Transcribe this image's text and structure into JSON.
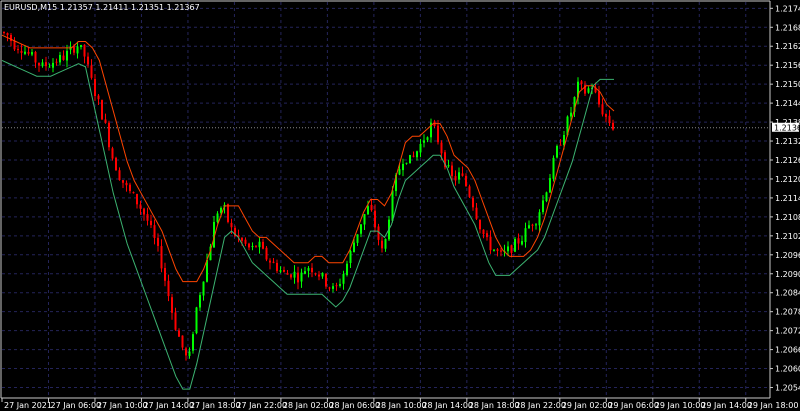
{
  "header": {
    "symbol_info": "EURUSD,M15  1.21357 1.21411 1.21351 1.21367"
  },
  "colors": {
    "background": "#000000",
    "grid": "#24245a",
    "axis": "#c8c8c8",
    "bull_candle": "#00ff00",
    "bear_candle": "#ff0000",
    "upper_band": "#ff4500",
    "lower_band": "#3cb371",
    "price_label_bg": "#ffffff",
    "price_label_text": "#000000"
  },
  "chart_data": {
    "type": "line",
    "title": "EURUSD,M15",
    "ohlc_header": "1.21357 1.21411 1.21351 1.21367",
    "current_price": 1.21367,
    "current_price_label": "1.21367",
    "grid": true,
    "y_axis_side": "right",
    "ylim": [
      1.20515,
      1.21765
    ],
    "yticks": [
      "1.21745",
      "1.21685",
      "1.21625",
      "1.21565",
      "1.21505",
      "1.21445",
      "1.21385",
      "1.21325",
      "1.21265",
      "1.21205",
      "1.21145",
      "1.21085",
      "1.21025",
      "1.20965",
      "1.20905",
      "1.20845",
      "1.20785",
      "1.20725",
      "1.20665",
      "1.20605",
      "1.20545"
    ],
    "xticks": [
      "27 Jan 2021",
      "27 Jan 06:00",
      "27 Jan 10:00",
      "27 Jan 14:00",
      "27 Jan 18:00",
      "27 Jan 22:00",
      "28 Jan 02:00",
      "28 Jan 06:00",
      "28 Jan 10:00",
      "28 Jan 14:00",
      "28 Jan 18:00",
      "28 Jan 22:00",
      "29 Jan 02:00",
      "29 Jan 06:00",
      "29 Jan 10:00",
      "29 Jan 14:00",
      "29 Jan 18:00"
    ],
    "price_path": [
      1.2167,
      1.2166,
      1.2163,
      1.2162,
      1.216,
      1.2158,
      1.2156,
      1.2157,
      1.2158,
      1.2159,
      1.2161,
      1.2163,
      1.216,
      1.2152,
      1.2145,
      1.2138,
      1.2128,
      1.2122,
      1.2118,
      1.2115,
      1.2112,
      1.2108,
      1.2102,
      1.2095,
      1.2085,
      1.2075,
      1.2068,
      1.2062,
      1.2078,
      1.2088,
      1.2098,
      1.211,
      1.2112,
      1.2105,
      1.2102,
      1.21,
      1.2098,
      1.21,
      1.2096,
      1.2094,
      1.2092,
      1.209,
      1.2091,
      1.2089,
      1.2093,
      1.2092,
      1.209,
      1.2087,
      1.2085,
      1.2089,
      1.2095,
      1.2102,
      1.2108,
      1.2112,
      1.2104,
      1.2096,
      1.2112,
      1.2122,
      1.2128,
      1.2126,
      1.213,
      1.2134,
      1.2138,
      1.2132,
      1.2125,
      1.212,
      1.2122,
      1.2118,
      1.2112,
      1.2105,
      1.21,
      1.2098,
      1.2096,
      1.2098,
      1.21,
      1.2102,
      1.2106,
      1.2108,
      1.2114,
      1.2122,
      1.213,
      1.2136,
      1.2142,
      1.215,
      1.2148,
      1.215,
      1.2144,
      1.214,
      1.2137
    ],
    "series": [
      {
        "name": "",
        "color": "#ff4500",
        "values": [
          1.2166,
          1.2165,
          1.2164,
          1.2163,
          1.2162,
          1.2162,
          1.2162,
          1.2162,
          1.2162,
          1.2162,
          1.2162,
          1.2164,
          1.2164,
          1.2162,
          1.2158,
          1.215,
          1.2142,
          1.2134,
          1.2126,
          1.212,
          1.2116,
          1.2112,
          1.2108,
          1.2104,
          1.2098,
          1.2092,
          1.2088,
          1.2088,
          1.2088,
          1.2092,
          1.2098,
          1.2106,
          1.2112,
          1.2112,
          1.2112,
          1.2108,
          1.2104,
          1.2102,
          1.2102,
          1.21,
          1.2098,
          1.2096,
          1.2094,
          1.2094,
          1.2094,
          1.2096,
          1.2096,
          1.2094,
          1.2094,
          1.2094,
          1.2098,
          1.2104,
          1.211,
          1.2114,
          1.2114,
          1.2112,
          1.2116,
          1.2124,
          1.2132,
          1.2134,
          1.2134,
          1.2136,
          1.2138,
          1.2138,
          1.2134,
          1.2128,
          1.2126,
          1.2124,
          1.212,
          1.2114,
          1.2108,
          1.2102,
          1.2098,
          1.2096,
          1.2096,
          1.2096,
          1.2098,
          1.2102,
          1.2108,
          1.2116,
          1.2124,
          1.2132,
          1.214,
          1.2148,
          1.215,
          1.215,
          1.2148,
          1.2144,
          1.2142
        ]
      },
      {
        "name": "",
        "color": "#3cb371",
        "values": [
          1.2158,
          1.2157,
          1.2156,
          1.2155,
          1.2154,
          1.2153,
          1.2153,
          1.2153,
          1.2154,
          1.2155,
          1.2156,
          1.2157,
          1.2156,
          1.2146,
          1.2136,
          1.2126,
          1.2116,
          1.2108,
          1.21,
          1.2094,
          1.2088,
          1.2082,
          1.2076,
          1.207,
          1.2064,
          1.2058,
          1.2054,
          1.2054,
          1.2062,
          1.2072,
          1.2082,
          1.2092,
          1.2102,
          1.2104,
          1.2102,
          1.2098,
          1.2094,
          1.2092,
          1.209,
          1.2088,
          1.2086,
          1.2084,
          1.2084,
          1.2084,
          1.2084,
          1.2084,
          1.2084,
          1.2082,
          1.208,
          1.2082,
          1.2086,
          1.2092,
          1.2098,
          1.2104,
          1.2104,
          1.2102,
          1.2106,
          1.2114,
          1.212,
          1.2122,
          1.2124,
          1.2126,
          1.2128,
          1.2128,
          1.2124,
          1.2118,
          1.2114,
          1.211,
          1.2106,
          1.21,
          1.2094,
          1.209,
          1.209,
          1.209,
          1.2092,
          1.2094,
          1.2096,
          1.2098,
          1.2102,
          1.2108,
          1.2114,
          1.212,
          1.2126,
          1.2134,
          1.2142,
          1.215,
          1.2152,
          1.2152,
          1.2152
        ]
      }
    ]
  }
}
